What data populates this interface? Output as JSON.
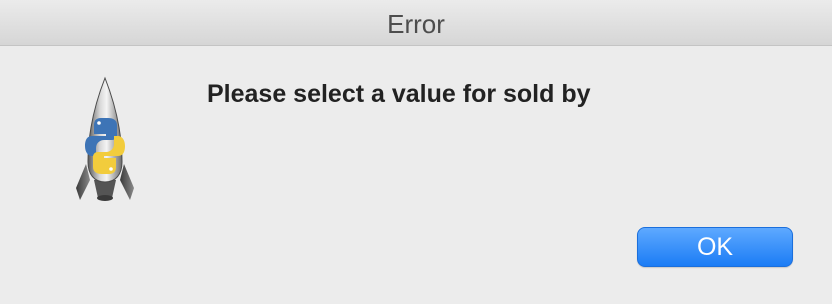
{
  "window": {
    "title": "Error"
  },
  "dialog": {
    "icon": "python-launcher-rocket-icon",
    "message": "Please select a value for sold by",
    "ok_label": "OK"
  },
  "colors": {
    "background": "#ececec",
    "button_accent": "#1b7cf5",
    "button_text": "#ffffff",
    "message_text": "#222222"
  }
}
